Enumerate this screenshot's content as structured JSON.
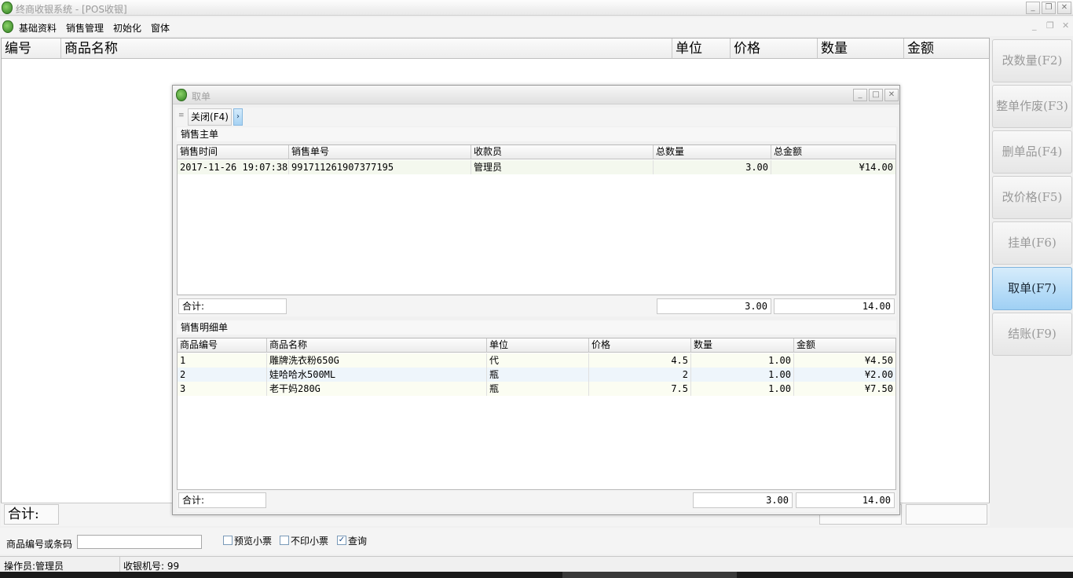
{
  "window": {
    "title": "终商收银系统 - [POS收银]"
  },
  "menu": [
    "基础资料",
    "销售管理",
    "初始化",
    "窗体"
  ],
  "main_table": {
    "headers": [
      "编号",
      "商品名称",
      "单位",
      "价格",
      "数量",
      "金额"
    ]
  },
  "main_total_label": "合计:",
  "function_buttons": [
    {
      "label": "改数量(F2)",
      "active": false
    },
    {
      "label": "整单作废(F3)",
      "active": false
    },
    {
      "label": "删单品(F4)",
      "active": false
    },
    {
      "label": "改价格(F5)",
      "active": false
    },
    {
      "label": "挂单(F6)",
      "active": false
    },
    {
      "label": "取单(F7)",
      "active": true
    },
    {
      "label": "结账(F9)",
      "active": false
    }
  ],
  "barcode": {
    "label": "商品编号或条码",
    "value": ""
  },
  "checkboxes": [
    {
      "label": "预览小票",
      "checked": false
    },
    {
      "label": "不印小票",
      "checked": false
    },
    {
      "label": "查询",
      "checked": true
    }
  ],
  "status": {
    "operator": "操作员:管理员",
    "terminal": "收银机号: 99"
  },
  "dialog": {
    "title": "取单",
    "close_button": "关闭(F4)",
    "master": {
      "section_title": "销售主单",
      "headers": [
        "销售时间",
        "销售单号",
        "收款员",
        "总数量",
        "总金额"
      ],
      "rows": [
        [
          "2017-11-26 19:07:38",
          "991711261907377195",
          "管理员",
          "3.00",
          "¥14.00"
        ]
      ],
      "total_label": "合计:",
      "total_qty": "3.00",
      "total_amount": "14.00"
    },
    "detail": {
      "section_title": "销售明细单",
      "headers": [
        "商品编号",
        "商品名称",
        "单位",
        "价格",
        "数量",
        "金额"
      ],
      "rows": [
        [
          "1",
          "雕牌洗衣粉650G",
          "代",
          "4.5",
          "1.00",
          "¥4.50"
        ],
        [
          "2",
          "娃哈哈水500ML",
          "瓶",
          "2",
          "1.00",
          "¥2.00"
        ],
        [
          "3",
          "老干妈280G",
          "瓶",
          "7.5",
          "1.00",
          "¥7.50"
        ]
      ],
      "total_label": "合计:",
      "total_qty": "3.00",
      "total_amount": "14.00"
    }
  }
}
